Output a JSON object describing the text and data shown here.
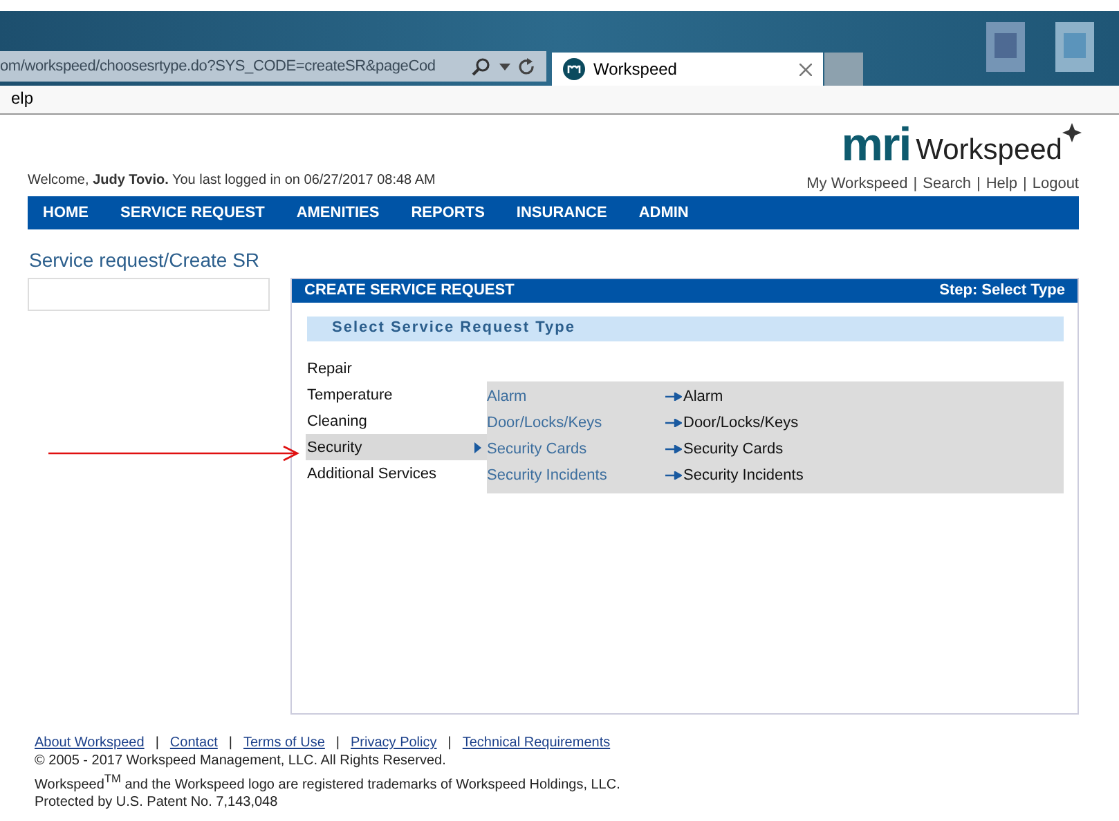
{
  "browser": {
    "address": "om/workspeed/choosesrtype.do?SYS_CODE=createSR&pageCod",
    "tab_title": "Workspeed",
    "menu_fragment": "elp"
  },
  "header": {
    "logo_mark": "mri",
    "logo_text": "Workspeed",
    "welcome": "Welcome, **Judy Tovio.** You last logged in on 06/27/2017 08:48 AM",
    "links": [
      "My Workspeed",
      "Search",
      "Help",
      "Logout"
    ],
    "separator": "|"
  },
  "nav": [
    {
      "label": "HOME"
    },
    {
      "label": "SERVICE REQUEST"
    },
    {
      "label": "AMENITIES"
    },
    {
      "label": "REPORTS"
    },
    {
      "label": "INSURANCE"
    },
    {
      "label": "ADMIN"
    }
  ],
  "breadcrumb": "Service request/Create SR",
  "panel": {
    "title": "CREATE SERVICE REQUEST",
    "step": "Step: Select Type",
    "subtitle": "Select Service Request Type",
    "categories": [
      {
        "label": "Repair",
        "selected": false
      },
      {
        "label": "Temperature",
        "selected": false
      },
      {
        "label": "Cleaning",
        "selected": false
      },
      {
        "label": "Security",
        "selected": true
      },
      {
        "label": "Additional Services",
        "selected": false
      }
    ],
    "subtypes": [
      {
        "label": "Alarm",
        "target": "Alarm"
      },
      {
        "label": "Door/Locks/Keys",
        "target": "Door/Locks/Keys"
      },
      {
        "label": "Security Cards",
        "target": "Security Cards"
      },
      {
        "label": "Security Incidents",
        "target": "Security Incidents"
      }
    ]
  },
  "footer": {
    "links": [
      "About Workspeed",
      "Contact",
      "Terms of Use",
      "Privacy Policy",
      "Technical Requirements"
    ],
    "separator": "|",
    "copyright": "© 2005 - 2017 Workspeed Management, LLC. All Rights Reserved.",
    "trademark": "Workspeed$^{TM}$ and the Workspeed logo are registered trademarks of Workspeed Holdings, LLC.",
    "patent": "Protected by U.S. Patent No. 7,143,048"
  }
}
